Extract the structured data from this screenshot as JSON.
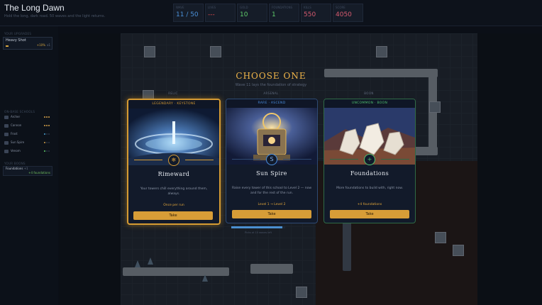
{
  "app": {
    "title": "The Long Dawn",
    "subtitle": "Hold the long, dark road. 50 waves and the light returns."
  },
  "stats": [
    {
      "label": "WAVE",
      "value": "11 / 50",
      "color": "#4a90d9"
    },
    {
      "label": "LIVES",
      "value": "---",
      "color": "#d84a4a"
    },
    {
      "label": "GOLD",
      "value": "10",
      "color": "#5fcb6a"
    },
    {
      "label": "FOUNDATIONS",
      "value": "1",
      "color": "#5fcb6a"
    },
    {
      "label": "KILLS",
      "value": "550",
      "color": "#d65a6f"
    },
    {
      "label": "SCORE",
      "value": "4050",
      "color": "#d65a6f"
    }
  ],
  "sidebar": {
    "upgrades_heading": "YOUR UPGRADES",
    "upgrade": {
      "name": "Heavy Shot",
      "pct": "+10%",
      "level": "x1",
      "progress": 0.1
    },
    "schools_heading": "ON-BASE SCHOOLS",
    "schools": [
      {
        "name": "Archer",
        "dots": [
          "#d4a04a",
          "#d4a04a",
          "#d4a04a"
        ]
      },
      {
        "name": "Cannon",
        "dots": [
          "#d4a04a",
          "#d4a04a",
          "#d4a04a"
        ]
      },
      {
        "name": "Frost",
        "dots": [
          "#4aa3d4",
          "#2a3344",
          "#2a3344"
        ]
      },
      {
        "name": "Sun Spire",
        "dots": [
          "#d4a04a",
          "#2a3344",
          "#2a3344"
        ]
      },
      {
        "name": "Venom",
        "dots": [
          "#5fcb6a",
          "#2a3344",
          "#2a3344"
        ]
      }
    ],
    "found_heading": "YOUR BOONS",
    "foundation": {
      "name": "Foundations",
      "count": "+1",
      "sub": "+4 foundations"
    }
  },
  "modal": {
    "title": "CHOOSE ONE",
    "subtitle": "Wave 11 lays the foundation of strategy",
    "categories": [
      "RELIC",
      "ARSENAL",
      "BOON"
    ],
    "cards": [
      {
        "rarity": "LEGENDARY · KEYSTONE",
        "name": "Rimeward",
        "description": "Your towers chill everything around them, always.",
        "note": "Once per run",
        "take": "Take",
        "emblem": "❄",
        "accent": "#e0a43c"
      },
      {
        "rarity": "RARE · ASCEND",
        "name": "Sun Spire",
        "description": "Raise every tower of this school to Level 2 — now and for the rest of the run.",
        "note": "Level 1 → Level 2",
        "take": "Take",
        "emblem": "S",
        "accent": "#4a8fe0"
      },
      {
        "rarity": "UNCOMMON · BOON",
        "name": "Foundations",
        "description": "More foundations to build with, right now.",
        "note": "+4 foundations",
        "take": "Take",
        "emblem": "+",
        "accent": "#4fc06f"
      }
    ],
    "progress_fraction": 0.95,
    "progress_label": "Picks at 10 waves left"
  }
}
